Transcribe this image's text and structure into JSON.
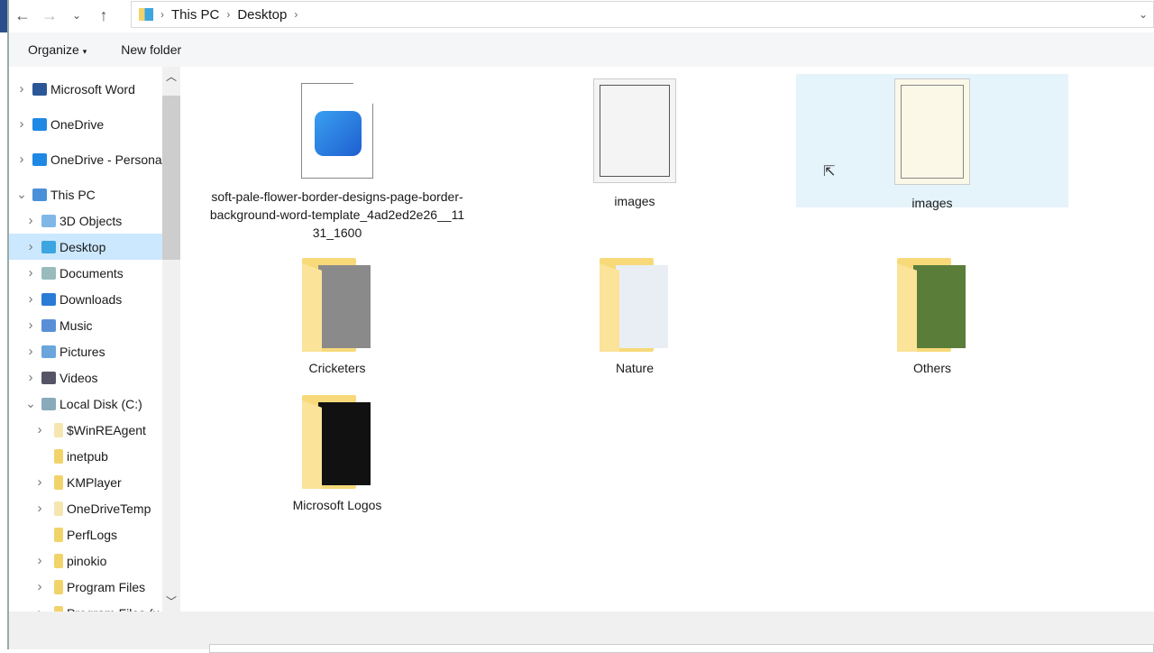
{
  "breadcrumb": [
    "This PC",
    "Desktop"
  ],
  "toolbar": {
    "organize": "Organize",
    "new_folder": "New folder"
  },
  "nav": [
    {
      "label": "Microsoft Word",
      "chev": ">",
      "color": "#2b5797",
      "indent": 0
    },
    {
      "label": "OneDrive",
      "chev": ">",
      "color": "#1e88e5",
      "indent": 0
    },
    {
      "label": "OneDrive - Persona",
      "chev": ">",
      "color": "#1e88e5",
      "indent": 0
    },
    {
      "label": "This PC",
      "chev": "v",
      "color": "#4a90d9",
      "indent": 0
    },
    {
      "label": "3D Objects",
      "chev": ">",
      "color": "#7fb8e6",
      "indent": 1
    },
    {
      "label": "Desktop",
      "chev": ">",
      "color": "#3da5e0",
      "indent": 1,
      "selected": true
    },
    {
      "label": "Documents",
      "chev": ">",
      "color": "#9bb",
      "indent": 1
    },
    {
      "label": "Downloads",
      "chev": ">",
      "color": "#2a7bd6",
      "indent": 1
    },
    {
      "label": "Music",
      "chev": ">",
      "color": "#5a8fd8",
      "indent": 1
    },
    {
      "label": "Pictures",
      "chev": ">",
      "color": "#6aa5dc",
      "indent": 1
    },
    {
      "label": "Videos",
      "chev": ">",
      "color": "#556",
      "indent": 1
    },
    {
      "label": "Local Disk (C:)",
      "chev": "v",
      "color": "#8ab",
      "indent": 1
    },
    {
      "label": "$WinREAgent",
      "chev": ">",
      "color": "#f5e6b0",
      "indent": 2
    },
    {
      "label": "inetpub",
      "chev": "",
      "color": "#f1d36a",
      "indent": 2
    },
    {
      "label": "KMPlayer",
      "chev": ">",
      "color": "#f1d36a",
      "indent": 2
    },
    {
      "label": "OneDriveTemp",
      "chev": ">",
      "color": "#f5e6b0",
      "indent": 2
    },
    {
      "label": "PerfLogs",
      "chev": "",
      "color": "#f1d36a",
      "indent": 2
    },
    {
      "label": "pinokio",
      "chev": ">",
      "color": "#f1d36a",
      "indent": 2
    },
    {
      "label": "Program Files",
      "chev": ">",
      "color": "#f1d36a",
      "indent": 2
    },
    {
      "label": "Program Files (x",
      "chev": ">",
      "color": "#f1d36a",
      "indent": 2
    }
  ],
  "items": [
    {
      "label": "soft-pale-flower-border-designs-page-border-background-word-template_4ad2ed2e26__1131_1600",
      "type": "image-file"
    },
    {
      "label": "images",
      "type": "border-thumb"
    },
    {
      "label": "images",
      "type": "flower-thumb",
      "selected": true
    },
    {
      "label": "Cricketers",
      "type": "folder",
      "pic": "#8a8a8a"
    },
    {
      "label": "Nature",
      "type": "folder",
      "pic": "#e8eef3"
    },
    {
      "label": "Others",
      "type": "folder",
      "pic": "#5a7d3a"
    },
    {
      "label": "Microsoft Logos",
      "type": "folder",
      "pic": "#111"
    }
  ]
}
